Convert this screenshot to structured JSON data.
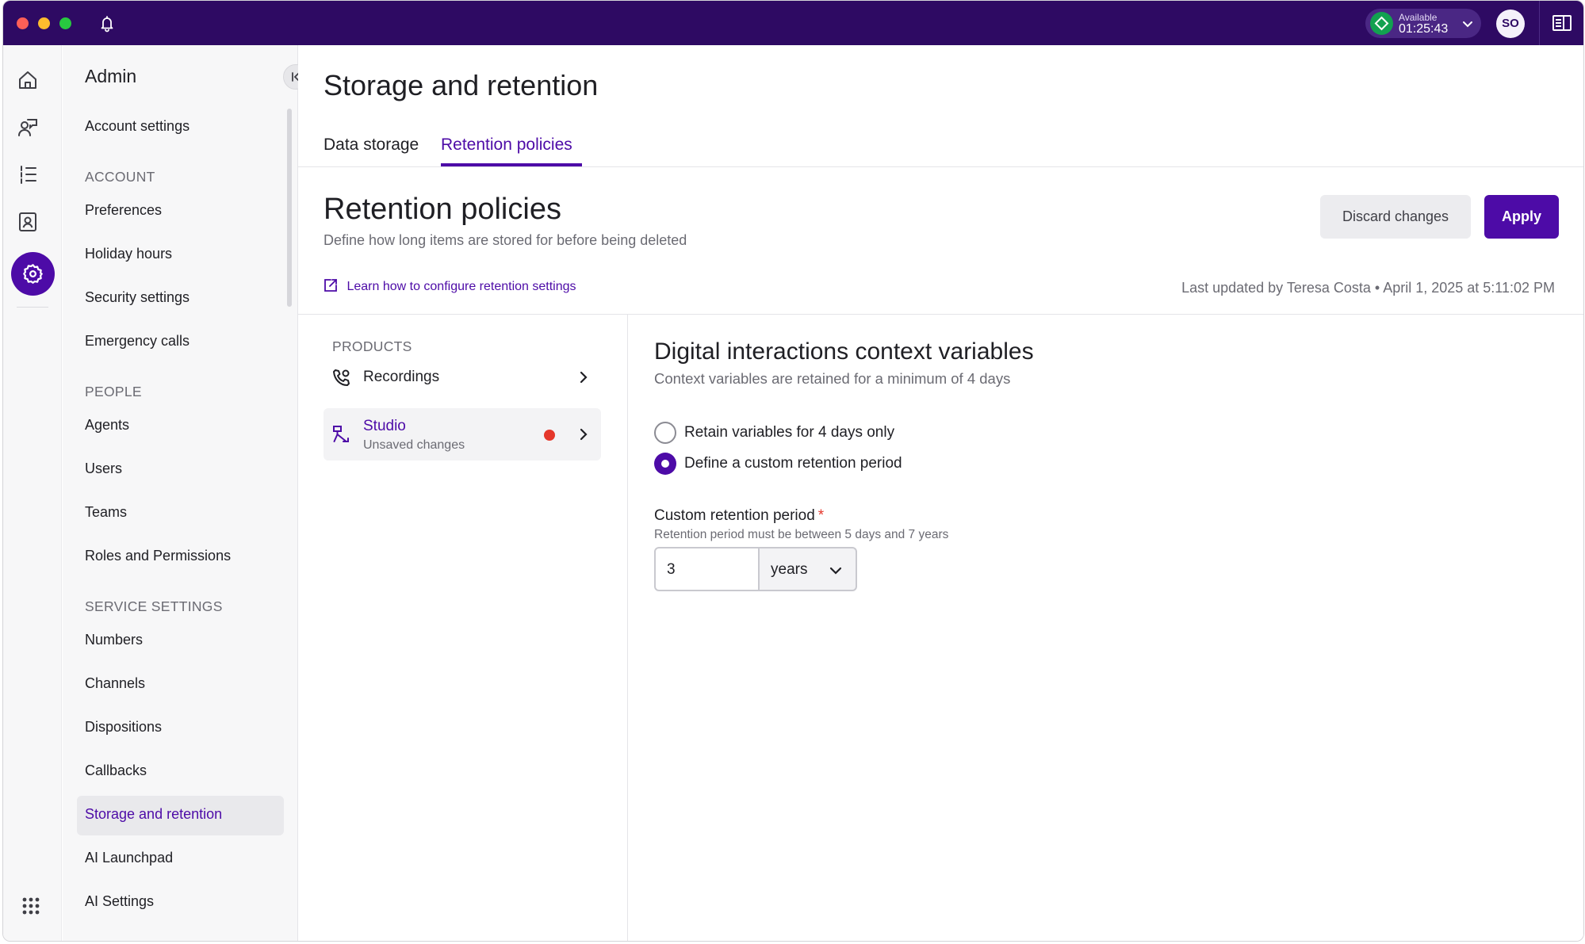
{
  "topbar": {
    "status_label": "Available",
    "status_time": "01:25:43",
    "avatar_initials": "SO"
  },
  "sidebar": {
    "title": "Admin",
    "top_item": "Account settings",
    "sections": [
      {
        "heading": "ACCOUNT",
        "items": [
          "Preferences",
          "Holiday hours",
          "Security settings",
          "Emergency calls"
        ]
      },
      {
        "heading": "PEOPLE",
        "items": [
          "Agents",
          "Users",
          "Teams",
          "Roles and Permissions"
        ]
      },
      {
        "heading": "SERVICE SETTINGS",
        "items": [
          "Numbers",
          "Channels",
          "Dispositions",
          "Callbacks",
          "Storage and retention",
          "AI Launchpad",
          "AI Settings"
        ]
      }
    ],
    "active_item": "Storage and retention"
  },
  "page": {
    "title": "Storage and retention",
    "tabs": [
      "Data storage",
      "Retention policies"
    ],
    "active_tab": "Retention policies"
  },
  "section": {
    "title": "Retention policies",
    "subtitle": "Define how long items are stored for before being deleted",
    "discard_label": "Discard changes",
    "apply_label": "Apply",
    "learn_link": "Learn how to configure retention settings",
    "last_updated": "Last updated by Teresa Costa • April 1, 2025 at 5:11:02 PM"
  },
  "products": {
    "heading": "PRODUCTS",
    "items": [
      {
        "name": "Recordings",
        "subtitle": ""
      },
      {
        "name": "Studio",
        "subtitle": "Unsaved changes"
      }
    ]
  },
  "details": {
    "title": "Digital interactions context variables",
    "subtitle": "Context variables are retained for a minimum of 4 days",
    "options": [
      {
        "label": "Retain variables for 4 days only",
        "selected": false
      },
      {
        "label": "Define a custom retention period",
        "selected": true
      }
    ],
    "field_label": "Custom retention period",
    "field_required": "*",
    "field_help": "Retention period must be between 5 days and 7 years",
    "field_value": "3",
    "unit_value": "years"
  },
  "colors": {
    "brand": "#2e0a63",
    "accent": "#4d0ba7",
    "status_green": "#12a150",
    "unsaved_dot": "#e5372b"
  },
  "icons": [
    "bell-icon",
    "chevron-down-icon",
    "panel-toggle-icon",
    "home-icon",
    "conversations-icon",
    "list-icon",
    "contacts-icon",
    "gear-icon",
    "apps-grid-icon",
    "collapse-icon",
    "external-link-icon",
    "phone-recording-icon",
    "studio-flow-icon",
    "chevron-right-icon"
  ]
}
